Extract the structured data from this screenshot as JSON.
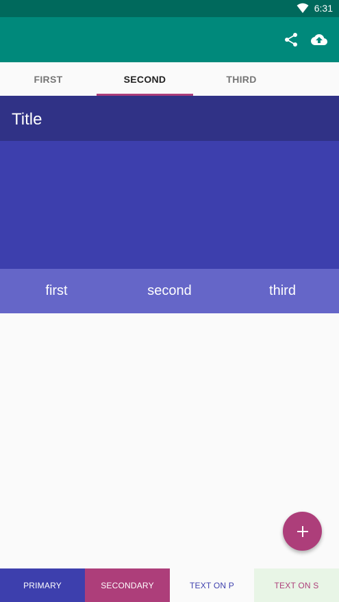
{
  "status_bar": {
    "time": "6:31",
    "icons": [
      "wifi-icon"
    ]
  },
  "app_bar": {
    "background": "#00897b",
    "actions": [
      {
        "icon": "share-icon"
      },
      {
        "icon": "cloud-upload-icon"
      }
    ]
  },
  "tabs": {
    "items": [
      {
        "label": "FIRST"
      },
      {
        "label": "SECOND"
      },
      {
        "label": "THIRD"
      }
    ],
    "selected": "SECOND",
    "indicator_color": "#ad3e7a"
  },
  "header": {
    "title": "Title"
  },
  "sub_tabs": {
    "items": [
      {
        "label": "first"
      },
      {
        "label": "second"
      },
      {
        "label": "third"
      }
    ]
  },
  "fab": {
    "icon": "plus-icon",
    "color": "#ad3e7a"
  },
  "bottom_bar": {
    "items": [
      {
        "label": "PRIMARY",
        "color": "#3d3fad"
      },
      {
        "label": "SECONDARY",
        "color": "#ad3e7a"
      },
      {
        "label": "TEXT ON P",
        "color": "#fafafa"
      },
      {
        "label": "TEXT ON S",
        "color": "#e8f5e6"
      }
    ]
  }
}
